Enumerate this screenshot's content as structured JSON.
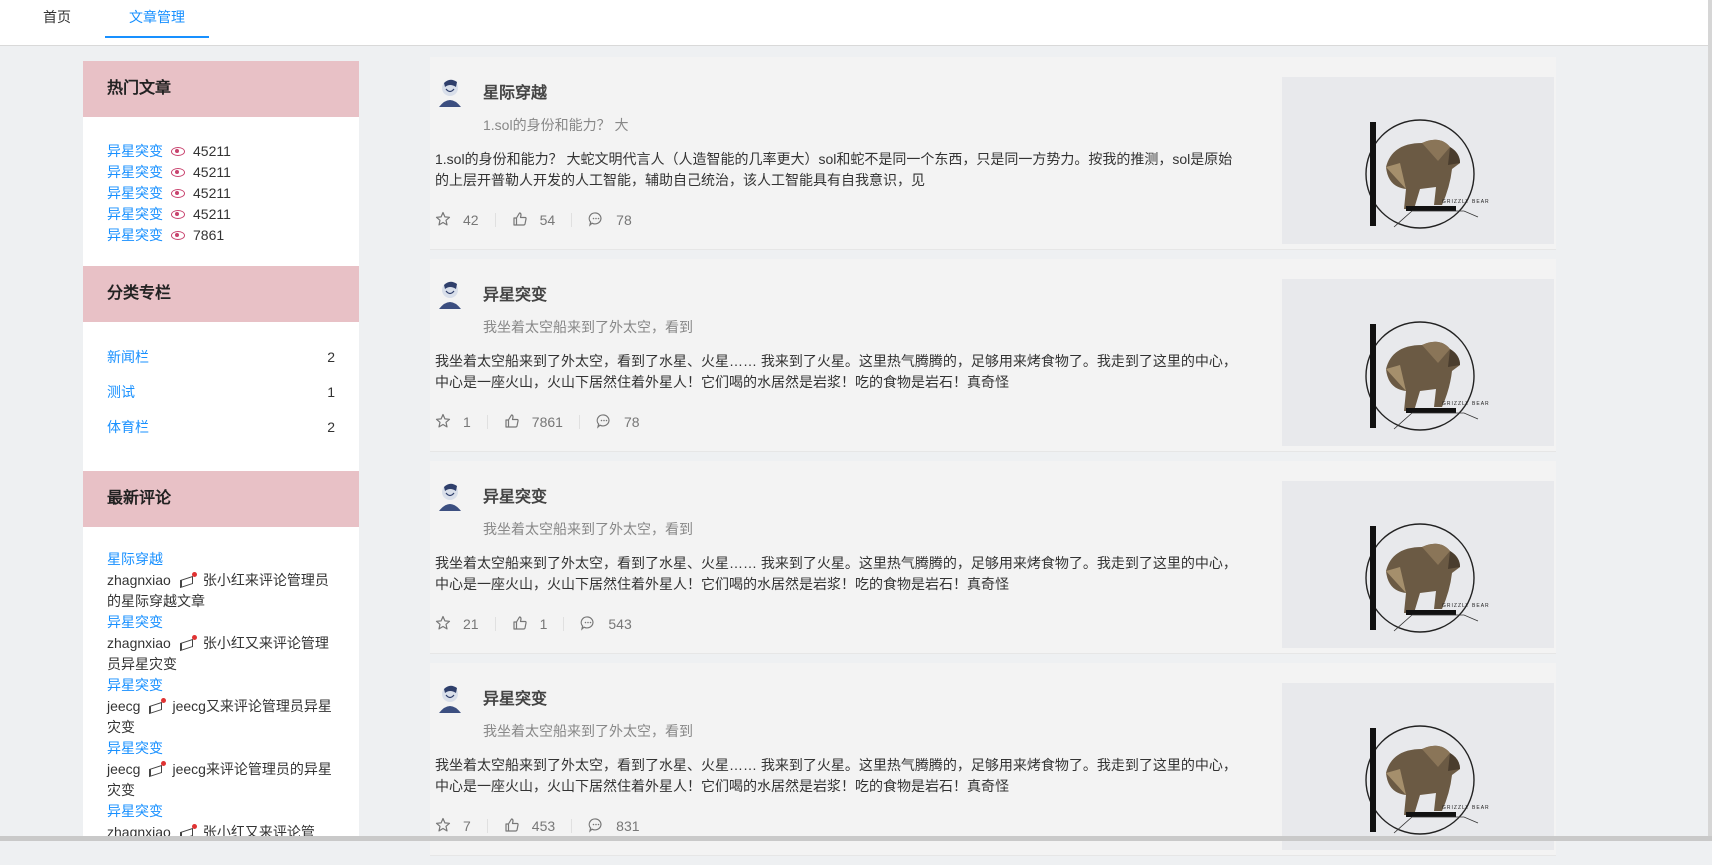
{
  "nav": {
    "home_label": "首页",
    "articles_label": "文章管理"
  },
  "sidebar": {
    "hot": {
      "title": "热门文章",
      "items": [
        {
          "title": "异星突变",
          "views": "45211"
        },
        {
          "title": "异星突变",
          "views": "45211"
        },
        {
          "title": "异星突变",
          "views": "45211"
        },
        {
          "title": "异星突变",
          "views": "45211"
        },
        {
          "title": "异星突变",
          "views": "7861"
        }
      ]
    },
    "categories": {
      "title": "分类专栏",
      "items": [
        {
          "name": "新闻栏",
          "count": "2"
        },
        {
          "name": "测试",
          "count": "1"
        },
        {
          "name": "体育栏",
          "count": "2"
        }
      ]
    },
    "comments": {
      "title": "最新评论",
      "items": [
        {
          "article": "星际穿越",
          "user": "zhagnxiao",
          "text": "张小红来评论管理员的星际穿越文章"
        },
        {
          "article": "异星突变",
          "user": "zhagnxiao",
          "text": "张小红又来评论管理员异星灾变"
        },
        {
          "article": "异星突变",
          "user": "jeecg",
          "text": "jeecg又来评论管理员异星灾变"
        },
        {
          "article": "异星突变",
          "user": "jeecg",
          "text": "jeecg来评论管理员的异星灾变"
        },
        {
          "article": "异星突变",
          "user": "zhagnxiao",
          "text": "张小红又来评论管"
        }
      ]
    }
  },
  "articles": [
    {
      "title": "星际穿越",
      "summary": "1.sol的身份和能力？  大",
      "body": "1.sol的身份和能力？  大蛇文明代言人（人造智能的几率更大）sol和蛇不是同一个东西，只是同一方势力。按我的推测，sol是原始的上层开普勒人开发的人工智能，辅助自己统治，该人工智能具有自我意识，见",
      "stars": "42",
      "likes": "54",
      "comments": "78"
    },
    {
      "title": "异星突变",
      "summary": "我坐着太空船来到了外太空，看到",
      "body": "我坐着太空船来到了外太空，看到了水星、火星…… 我来到了火星。这里热气腾腾的，足够用来烤食物了。我走到了这里的中心，中心是一座火山，火山下居然住着外星人！它们喝的水居然是岩浆！吃的食物是岩石！真奇怪",
      "stars": "1",
      "likes": "7861",
      "comments": "78"
    },
    {
      "title": "异星突变",
      "summary": "我坐着太空船来到了外太空，看到",
      "body": "我坐着太空船来到了外太空，看到了水星、火星…… 我来到了火星。这里热气腾腾的，足够用来烤食物了。我走到了这里的中心，中心是一座火山，火山下居然住着外星人！它们喝的水居然是岩浆！吃的食物是岩石！真奇怪",
      "stars": "21",
      "likes": "1",
      "comments": "543"
    },
    {
      "title": "异星突变",
      "summary": "我坐着太空船来到了外太空，看到",
      "body": "我坐着太空船来到了外太空，看到了水星、火星…… 我来到了火星。这里热气腾腾的，足够用来烤食物了。我走到了这里的中心，中心是一座火山，火山下居然住着外星人！它们喝的水居然是岩浆！吃的食物是岩石！真奇怪",
      "stars": "7",
      "likes": "453",
      "comments": "831"
    }
  ],
  "thumbnail_logo_text": "GRIZZLY BEAR",
  "icons": {
    "views": "eye-icon",
    "comment_marker": "megaphone-icon",
    "star": "star-icon",
    "like": "thumb-up-icon",
    "comment": "comment-icon",
    "avatar": "user-avatar"
  },
  "colors": {
    "accent": "#1890ff",
    "section_header": "#e8c1c6",
    "eye_icon": "#c8436e"
  }
}
